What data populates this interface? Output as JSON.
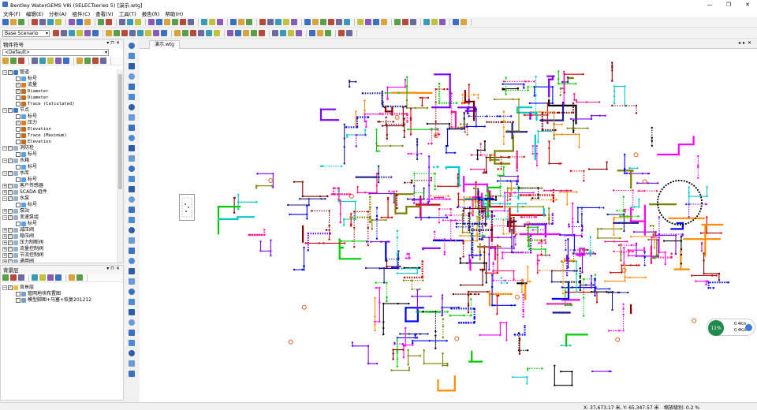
{
  "window": {
    "title": "Bentley WaterGEMS V8i (SELECTseries 5) [演示.wtg]",
    "controls": [
      "—",
      "❐",
      "✕"
    ]
  },
  "menu": [
    "文件(F)",
    "编辑(E)",
    "分析(A)",
    "组件(C)",
    "查看(V)",
    "工具(T)",
    "报告(R)",
    "帮助(H)"
  ],
  "toolbar": {
    "scenario": "Base Scenario"
  },
  "element_panel": {
    "title": "物件符号",
    "buttons": [
      "▾",
      "⊓",
      "✕"
    ],
    "filter": "<Default>",
    "tree": [
      {
        "level": 0,
        "toggle": "−",
        "checked": true,
        "icon": "#3a78d0",
        "label": "管道"
      },
      {
        "level": 1,
        "toggle": "",
        "checked": false,
        "icon": "#5aa0e8",
        "label": "标号"
      },
      {
        "level": 1,
        "toggle": "",
        "checked": true,
        "icon": "#e07b26",
        "label": "流量"
      },
      {
        "level": 1,
        "toggle": "",
        "checked": true,
        "icon": "#c46b1e",
        "label": "Diameter",
        "mono": true
      },
      {
        "level": 1,
        "toggle": "",
        "checked": false,
        "icon": "#c46b1e",
        "label": "Diameter",
        "mono": true
      },
      {
        "level": 1,
        "toggle": "",
        "checked": false,
        "icon": "#c46b1e",
        "label": "Trace (Calculated)",
        "mono": true
      },
      {
        "level": 0,
        "toggle": "−",
        "checked": true,
        "icon": "#3a78d0",
        "label": "节点"
      },
      {
        "level": 1,
        "toggle": "",
        "checked": false,
        "icon": "#5aa0e8",
        "label": "标号"
      },
      {
        "level": 1,
        "toggle": "",
        "checked": true,
        "icon": "#e07b26",
        "label": "压力"
      },
      {
        "level": 1,
        "toggle": "",
        "checked": false,
        "icon": "#c46b1e",
        "label": "Elevation",
        "mono": true
      },
      {
        "level": 1,
        "toggle": "",
        "checked": false,
        "icon": "#c46b1e",
        "label": "Trace (Maximum)",
        "mono": true
      },
      {
        "level": 1,
        "toggle": "",
        "checked": false,
        "icon": "#c46b1e",
        "label": "Elevation",
        "mono": true
      },
      {
        "level": 0,
        "toggle": "−",
        "checked": true,
        "icon": "#9ab0c8",
        "label": "消防栓"
      },
      {
        "level": 1,
        "toggle": "",
        "checked": false,
        "icon": "#5aa0e8",
        "label": "标号"
      },
      {
        "level": 0,
        "toggle": "−",
        "checked": true,
        "icon": "#9ab0c8",
        "label": "水箱"
      },
      {
        "level": 1,
        "toggle": "",
        "checked": false,
        "icon": "#5aa0e8",
        "label": "标号"
      },
      {
        "level": 0,
        "toggle": "−",
        "checked": true,
        "icon": "#9ab0c8",
        "label": "水库"
      },
      {
        "level": 1,
        "toggle": "",
        "checked": false,
        "icon": "#5aa0e8",
        "label": "标号"
      },
      {
        "level": 0,
        "toggle": "+",
        "checked": true,
        "icon": "#9ab0c8",
        "label": "客户传感器"
      },
      {
        "level": 0,
        "toggle": "+",
        "checked": true,
        "icon": "#9ab0c8",
        "label": "SCADA 组件"
      },
      {
        "level": 0,
        "toggle": "−",
        "checked": true,
        "icon": "#9ab0c8",
        "label": "水泵"
      },
      {
        "level": 1,
        "toggle": "",
        "checked": false,
        "icon": "#5aa0e8",
        "label": "标号"
      },
      {
        "level": 0,
        "toggle": "+",
        "checked": true,
        "icon": "#9ab0c8",
        "label": "泵站"
      },
      {
        "level": 0,
        "toggle": "−",
        "checked": true,
        "icon": "#9ab0c8",
        "label": "变速泵组"
      },
      {
        "level": 1,
        "toggle": "",
        "checked": false,
        "icon": "#5aa0e8",
        "label": "标号"
      },
      {
        "level": 0,
        "toggle": "+",
        "checked": true,
        "icon": "#9ab0c8",
        "label": "减压阀"
      },
      {
        "level": 0,
        "toggle": "+",
        "checked": true,
        "icon": "#9ab0c8",
        "label": "稳压阀"
      },
      {
        "level": 0,
        "toggle": "+",
        "checked": true,
        "icon": "#9ab0c8",
        "label": "压力制断阀"
      },
      {
        "level": 0,
        "toggle": "+",
        "checked": true,
        "icon": "#9ab0c8",
        "label": "流量控制阀"
      },
      {
        "level": 0,
        "toggle": "+",
        "checked": true,
        "icon": "#9ab0c8",
        "label": "节流控制阀"
      },
      {
        "level": 0,
        "toggle": "+",
        "checked": true,
        "icon": "#9ab0c8",
        "label": "通用阀"
      }
    ]
  },
  "background_panel": {
    "title": "背景层",
    "buttons": [
      "▾",
      "⊓",
      "✕"
    ],
    "tree": [
      {
        "level": 0,
        "toggle": "−",
        "checked": true,
        "icon": "#e9c13a",
        "label": "背景层"
      },
      {
        "level": 1,
        "toggle": "",
        "checked": false,
        "icon": "#7a9cc2",
        "label": "管网地块布置图"
      },
      {
        "level": 1,
        "toggle": "",
        "checked": false,
        "icon": "#7a9cc2",
        "label": "模型脚图+马塞+恢复201212"
      }
    ]
  },
  "drawing": {
    "tab": "演示.wtg",
    "tab_controls": [
      "◂",
      "▸",
      "✕"
    ]
  },
  "network": {
    "colors": [
      "#0000ff",
      "#ff00ff",
      "#ff1493",
      "#cc0000",
      "#000000",
      "#00cc00",
      "#00c8c8",
      "#800000",
      "#ff8c00",
      "#1e1e8c",
      "#7f00ff",
      "#808000"
    ]
  },
  "gauge": {
    "percent": "11%",
    "up": "0.4K/s",
    "down": "0.4K/s"
  },
  "status": {
    "coords": "X: 37,673.17 米, Y: 65,347.57 米",
    "zoom": "缩放级别: 0.2 %"
  }
}
